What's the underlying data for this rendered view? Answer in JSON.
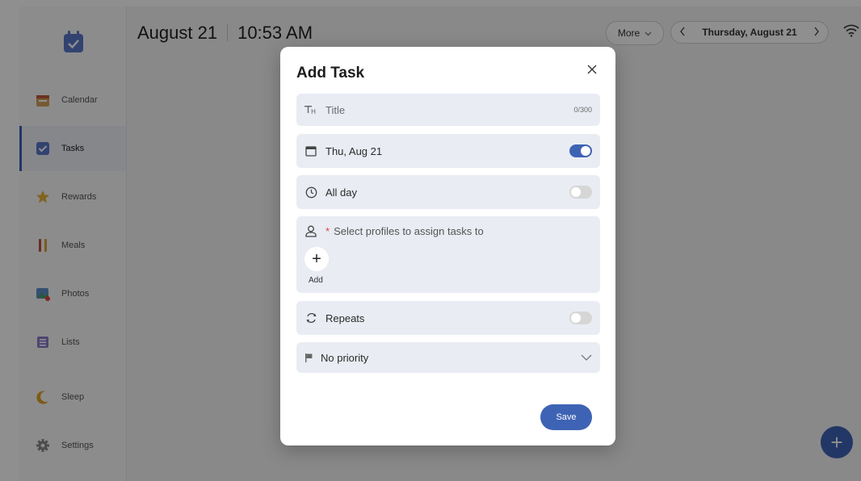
{
  "header": {
    "date": "August 21",
    "time": "10:53 AM"
  },
  "topbar": {
    "more_label": "More",
    "current_date": "Thursday, August 21"
  },
  "sidebar": {
    "items": [
      {
        "label": "Calendar",
        "icon": "calendar-icon"
      },
      {
        "label": "Tasks",
        "icon": "tasks-icon",
        "active": true
      },
      {
        "label": "Rewards",
        "icon": "star-icon"
      },
      {
        "label": "Meals",
        "icon": "utensils-icon"
      },
      {
        "label": "Photos",
        "icon": "photos-icon"
      },
      {
        "label": "Lists",
        "icon": "list-icon"
      },
      {
        "label": "Sleep",
        "icon": "moon-icon"
      },
      {
        "label": "Settings",
        "icon": "gear-icon"
      }
    ]
  },
  "dialog": {
    "title": "Add Task",
    "title_field": {
      "placeholder": "Title",
      "counter": "0/300"
    },
    "date_field": {
      "value": "Thu, Aug 21",
      "toggle": "on"
    },
    "all_day": {
      "label": "All day",
      "toggle": "off"
    },
    "assign": {
      "required_mark": "*",
      "label": "Select profiles to assign tasks to",
      "add_label": "Add"
    },
    "repeats": {
      "label": "Repeats",
      "toggle": "off"
    },
    "priority": {
      "value": "No priority"
    },
    "save_label": "Save"
  },
  "colors": {
    "accent": "#3e63b5",
    "required": "#e0443b"
  }
}
